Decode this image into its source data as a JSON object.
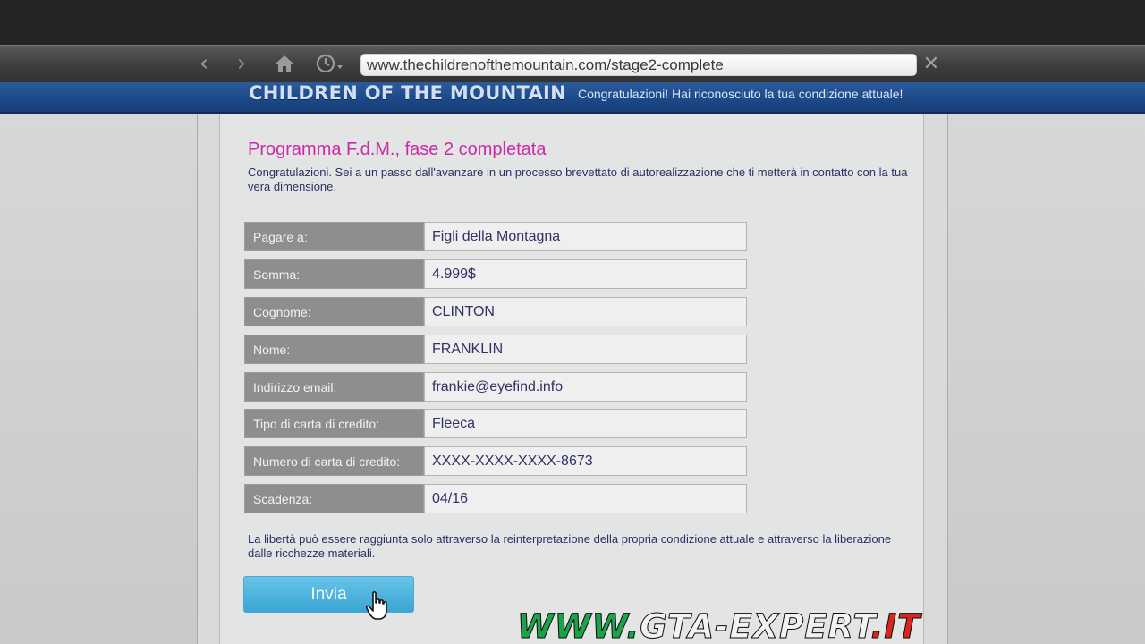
{
  "browser": {
    "url": "www.thechildrenofthemountain.com/stage2-complete",
    "icons": {
      "back": "chevron-left-icon",
      "forward": "chevron-right-icon",
      "home": "home-icon",
      "history": "clock-icon",
      "close": "close-icon"
    }
  },
  "site": {
    "title": "CHILDREN OF THE MOUNTAIN",
    "tagline": "Congratulazioni! Hai riconosciuto la tua condizione attuale!"
  },
  "page": {
    "heading": "Programma F.d.M., fase 2 completata",
    "intro": "Congratulazioni. Sei a un passo dall'avanzare in un processo brevettato di autorealizzazione che ti metterà in contatto con la tua vera dimensione.",
    "form": [
      {
        "label": "Pagare a:",
        "value": "Figli della Montagna"
      },
      {
        "label": "Somma:",
        "value": "4.999$"
      },
      {
        "label": "Cognome:",
        "value": "CLINTON"
      },
      {
        "label": "Nome:",
        "value": "FRANKLIN"
      },
      {
        "label": "Indirizzo email:",
        "value": "frankie@eyefind.info"
      },
      {
        "label": "Tipo di carta di credito:",
        "value": "Fleeca"
      },
      {
        "label": "Numero di carta di credito:",
        "value": "XXXX-XXXX-XXXX-8673"
      },
      {
        "label": "Scadenza:",
        "value": "04/16"
      }
    ],
    "footer": "La libertà può essere raggiunta solo attraverso la reinterpretazione della propria condizione attuale e attraverso la liberazione dalle ricchezze materiali.",
    "submit_label": "Invia"
  },
  "watermark": {
    "part1": "WWW.",
    "part2": "GTA-EXPERT",
    "part3": ".IT"
  },
  "colors": {
    "heading": "#cc2aa8",
    "header_bar": "#1d4a8a",
    "button": "#46afd9",
    "watermark_green": "#19a34a",
    "watermark_white": "#f2f2f2",
    "watermark_red": "#d8261f"
  }
}
